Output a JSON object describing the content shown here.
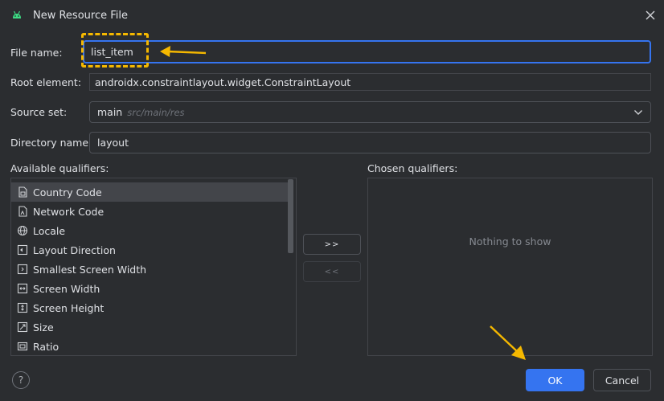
{
  "window": {
    "title": "New Resource File"
  },
  "form": {
    "file_name_label": "File name:",
    "file_name_value": "list_item",
    "root_element_label": "Root element:",
    "root_element_value": "androidx.constraintlayout.widget.ConstraintLayout",
    "source_set_label": "Source set:",
    "source_set_value": "main",
    "source_set_hint": "src/main/res",
    "directory_name_label": "Directory name:",
    "directory_name_value": "layout"
  },
  "qualifiers": {
    "available_label": "Available qualifiers:",
    "chosen_label": "Chosen qualifiers:",
    "empty_text": "Nothing to show",
    "add_button": ">>",
    "remove_button": "<<",
    "items": [
      {
        "label": "Country Code",
        "icon": "sim-card-icon"
      },
      {
        "label": "Network Code",
        "icon": "network-icon"
      },
      {
        "label": "Locale",
        "icon": "globe-icon"
      },
      {
        "label": "Layout Direction",
        "icon": "layout-direction-icon"
      },
      {
        "label": "Smallest Screen Width",
        "icon": "smallest-width-icon"
      },
      {
        "label": "Screen Width",
        "icon": "screen-width-icon"
      },
      {
        "label": "Screen Height",
        "icon": "screen-height-icon"
      },
      {
        "label": "Size",
        "icon": "size-icon"
      },
      {
        "label": "Ratio",
        "icon": "ratio-icon"
      }
    ]
  },
  "footer": {
    "help_label": "?",
    "ok_label": "OK",
    "cancel_label": "Cancel"
  },
  "colors": {
    "background": "#2b2d30",
    "accent": "#3574f0",
    "annotation": "#f5b800"
  }
}
